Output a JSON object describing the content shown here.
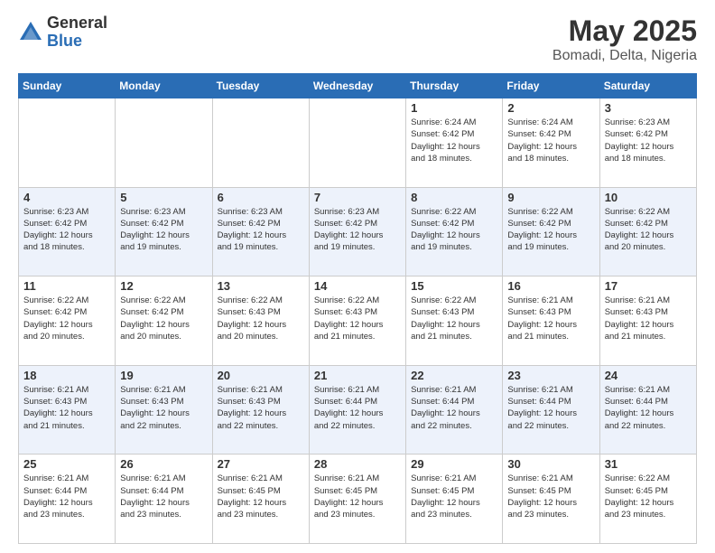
{
  "header": {
    "logo_general": "General",
    "logo_blue": "Blue",
    "month": "May 2025",
    "location": "Bomadi, Delta, Nigeria"
  },
  "weekdays": [
    "Sunday",
    "Monday",
    "Tuesday",
    "Wednesday",
    "Thursday",
    "Friday",
    "Saturday"
  ],
  "weeks": [
    [
      {
        "day": "",
        "info": ""
      },
      {
        "day": "",
        "info": ""
      },
      {
        "day": "",
        "info": ""
      },
      {
        "day": "",
        "info": ""
      },
      {
        "day": "1",
        "info": "Sunrise: 6:24 AM\nSunset: 6:42 PM\nDaylight: 12 hours\nand 18 minutes."
      },
      {
        "day": "2",
        "info": "Sunrise: 6:24 AM\nSunset: 6:42 PM\nDaylight: 12 hours\nand 18 minutes."
      },
      {
        "day": "3",
        "info": "Sunrise: 6:23 AM\nSunset: 6:42 PM\nDaylight: 12 hours\nand 18 minutes."
      }
    ],
    [
      {
        "day": "4",
        "info": "Sunrise: 6:23 AM\nSunset: 6:42 PM\nDaylight: 12 hours\nand 18 minutes."
      },
      {
        "day": "5",
        "info": "Sunrise: 6:23 AM\nSunset: 6:42 PM\nDaylight: 12 hours\nand 19 minutes."
      },
      {
        "day": "6",
        "info": "Sunrise: 6:23 AM\nSunset: 6:42 PM\nDaylight: 12 hours\nand 19 minutes."
      },
      {
        "day": "7",
        "info": "Sunrise: 6:23 AM\nSunset: 6:42 PM\nDaylight: 12 hours\nand 19 minutes."
      },
      {
        "day": "8",
        "info": "Sunrise: 6:22 AM\nSunset: 6:42 PM\nDaylight: 12 hours\nand 19 minutes."
      },
      {
        "day": "9",
        "info": "Sunrise: 6:22 AM\nSunset: 6:42 PM\nDaylight: 12 hours\nand 19 minutes."
      },
      {
        "day": "10",
        "info": "Sunrise: 6:22 AM\nSunset: 6:42 PM\nDaylight: 12 hours\nand 20 minutes."
      }
    ],
    [
      {
        "day": "11",
        "info": "Sunrise: 6:22 AM\nSunset: 6:42 PM\nDaylight: 12 hours\nand 20 minutes."
      },
      {
        "day": "12",
        "info": "Sunrise: 6:22 AM\nSunset: 6:42 PM\nDaylight: 12 hours\nand 20 minutes."
      },
      {
        "day": "13",
        "info": "Sunrise: 6:22 AM\nSunset: 6:43 PM\nDaylight: 12 hours\nand 20 minutes."
      },
      {
        "day": "14",
        "info": "Sunrise: 6:22 AM\nSunset: 6:43 PM\nDaylight: 12 hours\nand 21 minutes."
      },
      {
        "day": "15",
        "info": "Sunrise: 6:22 AM\nSunset: 6:43 PM\nDaylight: 12 hours\nand 21 minutes."
      },
      {
        "day": "16",
        "info": "Sunrise: 6:21 AM\nSunset: 6:43 PM\nDaylight: 12 hours\nand 21 minutes."
      },
      {
        "day": "17",
        "info": "Sunrise: 6:21 AM\nSunset: 6:43 PM\nDaylight: 12 hours\nand 21 minutes."
      }
    ],
    [
      {
        "day": "18",
        "info": "Sunrise: 6:21 AM\nSunset: 6:43 PM\nDaylight: 12 hours\nand 21 minutes."
      },
      {
        "day": "19",
        "info": "Sunrise: 6:21 AM\nSunset: 6:43 PM\nDaylight: 12 hours\nand 22 minutes."
      },
      {
        "day": "20",
        "info": "Sunrise: 6:21 AM\nSunset: 6:43 PM\nDaylight: 12 hours\nand 22 minutes."
      },
      {
        "day": "21",
        "info": "Sunrise: 6:21 AM\nSunset: 6:44 PM\nDaylight: 12 hours\nand 22 minutes."
      },
      {
        "day": "22",
        "info": "Sunrise: 6:21 AM\nSunset: 6:44 PM\nDaylight: 12 hours\nand 22 minutes."
      },
      {
        "day": "23",
        "info": "Sunrise: 6:21 AM\nSunset: 6:44 PM\nDaylight: 12 hours\nand 22 minutes."
      },
      {
        "day": "24",
        "info": "Sunrise: 6:21 AM\nSunset: 6:44 PM\nDaylight: 12 hours\nand 22 minutes."
      }
    ],
    [
      {
        "day": "25",
        "info": "Sunrise: 6:21 AM\nSunset: 6:44 PM\nDaylight: 12 hours\nand 23 minutes."
      },
      {
        "day": "26",
        "info": "Sunrise: 6:21 AM\nSunset: 6:44 PM\nDaylight: 12 hours\nand 23 minutes."
      },
      {
        "day": "27",
        "info": "Sunrise: 6:21 AM\nSunset: 6:45 PM\nDaylight: 12 hours\nand 23 minutes."
      },
      {
        "day": "28",
        "info": "Sunrise: 6:21 AM\nSunset: 6:45 PM\nDaylight: 12 hours\nand 23 minutes."
      },
      {
        "day": "29",
        "info": "Sunrise: 6:21 AM\nSunset: 6:45 PM\nDaylight: 12 hours\nand 23 minutes."
      },
      {
        "day": "30",
        "info": "Sunrise: 6:21 AM\nSunset: 6:45 PM\nDaylight: 12 hours\nand 23 minutes."
      },
      {
        "day": "31",
        "info": "Sunrise: 6:22 AM\nSunset: 6:45 PM\nDaylight: 12 hours\nand 23 minutes."
      }
    ]
  ]
}
